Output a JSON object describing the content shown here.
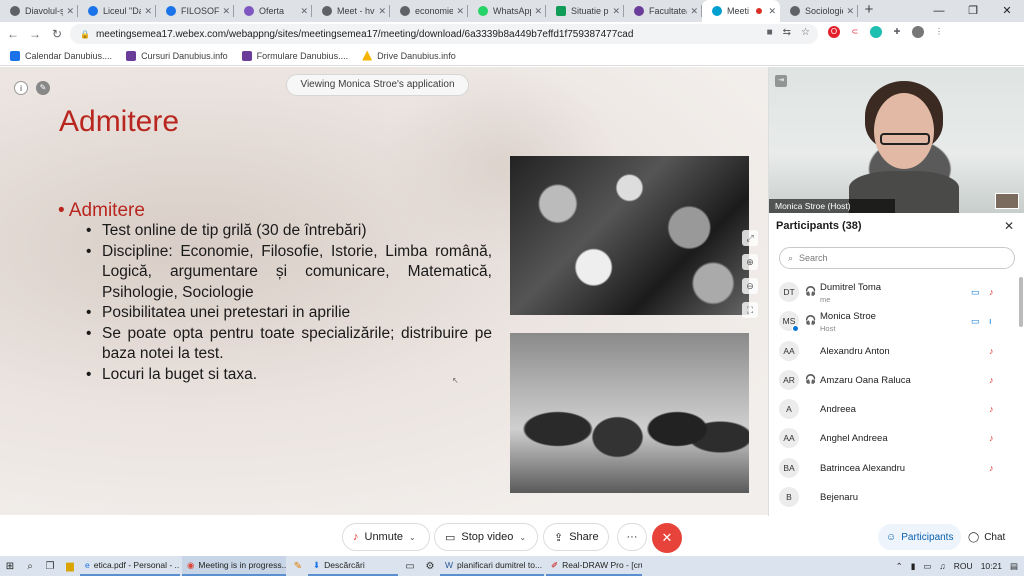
{
  "tabs": [
    {
      "label": "Diavolul-ș",
      "color": "#5f6368"
    },
    {
      "label": "Liceul \"Da",
      "color": "#1a73e8"
    },
    {
      "label": "FILOSOFIE",
      "color": "#1a73e8"
    },
    {
      "label": "Oferta",
      "color": "#7e57c2"
    },
    {
      "label": "Meet - hvi",
      "color": "#5f6368"
    },
    {
      "label": "economie",
      "color": "#5f6368"
    },
    {
      "label": "WhatsApp",
      "color": "#25d366"
    },
    {
      "label": "Situatie p",
      "color": "#0f9d58"
    },
    {
      "label": "Facultatea",
      "color": "#6a3d9a"
    },
    {
      "label": "Meeti",
      "color": "#00a0d1",
      "active": true
    },
    {
      "label": "Sociologie",
      "color": "#5f6368"
    }
  ],
  "new_tab": "+",
  "window": {
    "minimize": "—",
    "maximize": "❐",
    "close": "✕"
  },
  "address": {
    "url": "meetingsemea17.webex.com/webappng/sites/meetingsemea17/meeting/download/6a3339b8a449b7effd1f759387477cad"
  },
  "bookmarks": [
    {
      "label": "Calendar Danubius....",
      "color": "#1a73e8"
    },
    {
      "label": "Cursuri Danubius.info",
      "color": "#6a3d9a"
    },
    {
      "label": "Formulare Danubius....",
      "color": "#6a3d9a"
    },
    {
      "label": "Drive Danubius.info",
      "color": "#f4b400"
    }
  ],
  "slide": {
    "viewing": "Viewing Monica Stroe's application",
    "title": "Admitere",
    "bullet": "• Admitere",
    "items": [
      "Test online de tip grilă (30 de întrebări)",
      "Discipline: Economie, Filosofie, Istorie, Limba română, Logică, argumentare și comunicare, Matematică, Psihologie, Sociologie",
      "Posibilitatea unei pretestari in aprilie",
      "Se poate opta pentru toate specializările; distribuire pe baza notei la test.",
      "Locuri la buget si taxa."
    ],
    "accent": "#b8261f"
  },
  "video": {
    "label": "Monica Stroe (Host)"
  },
  "participants": {
    "title": "Participants (38)",
    "search_placeholder": "Search",
    "list": [
      {
        "initials": "DT",
        "name": "Dumitrel Toma",
        "sub": "me",
        "cam": true,
        "mic": "muted"
      },
      {
        "initials": "MS",
        "name": "Monica Stroe",
        "sub": "Host",
        "cam": true,
        "mic": "active"
      },
      {
        "initials": "AA",
        "name": "Alexandru Anton",
        "mic": "muted"
      },
      {
        "initials": "AR",
        "name": "Amzaru Oana Raluca",
        "mic": "muted"
      },
      {
        "initials": "A",
        "name": "Andreea",
        "mic": "muted"
      },
      {
        "initials": "AA",
        "name": "Anghel Andreea",
        "mic": "muted"
      },
      {
        "initials": "BA",
        "name": "Batrincea Alexandru",
        "mic": "muted"
      },
      {
        "initials": "B",
        "name": "Bejenaru",
        "mic": "muted"
      }
    ]
  },
  "controls": {
    "unmute": "Unmute",
    "stop_video": "Stop video",
    "share": "Share",
    "more": "···",
    "end": "✕",
    "participants": "Participants",
    "chat": "Chat"
  },
  "taskbar": {
    "apps": [
      "etica.pdf - Personal - ...",
      "Meeting is in progress...",
      "Descărcări",
      "planificari dumitrel to...",
      "Real-DRAW Pro - [cru..."
    ],
    "lang": "ROU",
    "time": "10:21"
  }
}
